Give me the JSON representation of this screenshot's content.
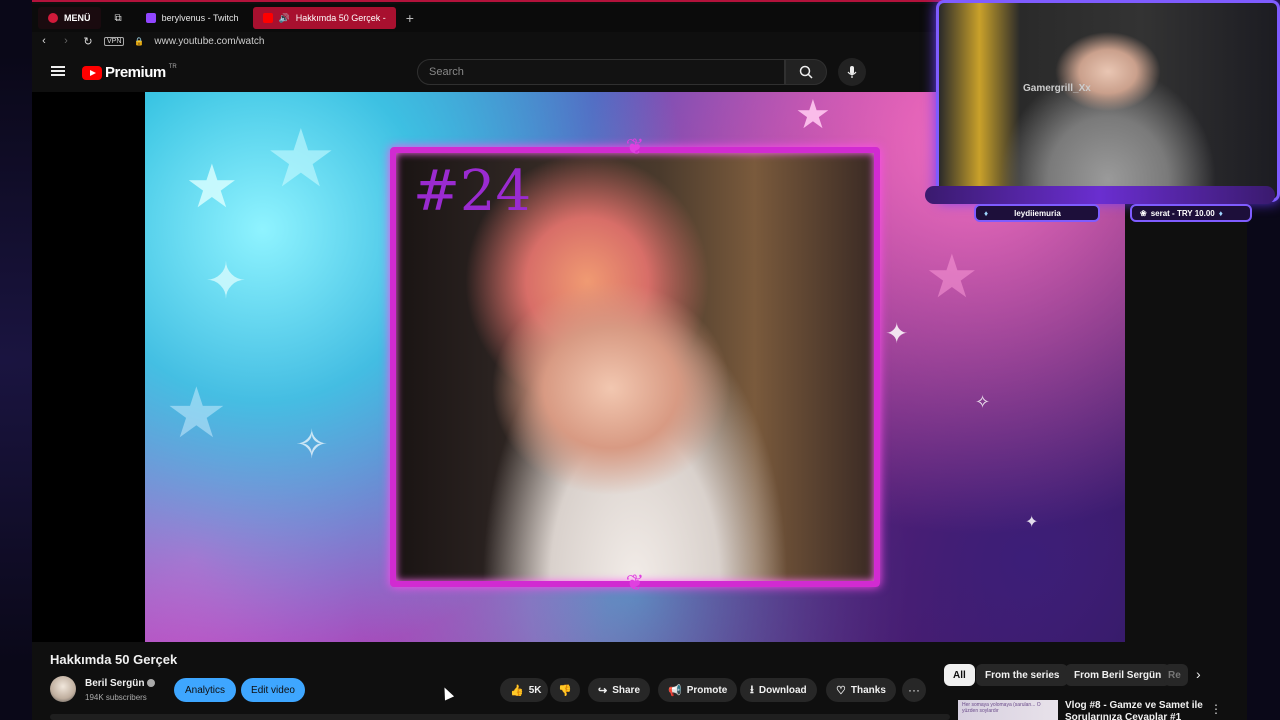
{
  "browser": {
    "menu_label": "MENÜ",
    "tabs": [
      {
        "label": "berylvenus - Twitch",
        "color": "#9146ff"
      },
      {
        "label": "Hakkımda 50 Gerçek -",
        "color": "#ff0000"
      }
    ],
    "add_tab": "+",
    "vpn_badge": "VPN",
    "url": "www.youtube.com/watch"
  },
  "youtube": {
    "logo_word": "Premium",
    "logo_tm": "TR",
    "search_placeholder": "Search"
  },
  "video": {
    "overlay_number": "#24",
    "frame_ornament": "❦",
    "title": "Hakkımda 50 Gerçek"
  },
  "stream_overlay": {
    "chair_text": "Gamergrill_Xx",
    "viewer_pill": "leydiiemuria",
    "tip_pill": "serat - TRY 10.00"
  },
  "channel": {
    "name": "Beril Sergün",
    "subscribers": "194K subscribers",
    "analytics_label": "Analytics",
    "edit_label": "Edit video"
  },
  "actions": {
    "like_count": "5K",
    "share_label": "Share",
    "promote_label": "Promote",
    "download_label": "Download",
    "thanks_label": "Thanks",
    "more_label": "···"
  },
  "sidebar": {
    "chips": [
      "All",
      "From the series",
      "From Beril Sergün",
      "Re"
    ],
    "rec_thumb_text": "Her somaya yolomaya (sarulan... O yüzden soylardır",
    "rec_title": "Vlog #8 - Gamze ve Samet ile Sorularınıza Cevaplar #1",
    "rec_menu": "⋮"
  },
  "colors": {
    "accent": "#3ea6ff",
    "brand_red": "#ff0000",
    "tab_active": "#a8102f",
    "frame_magenta": "#d12bd1",
    "overlay_purple": "#7f5cff"
  }
}
